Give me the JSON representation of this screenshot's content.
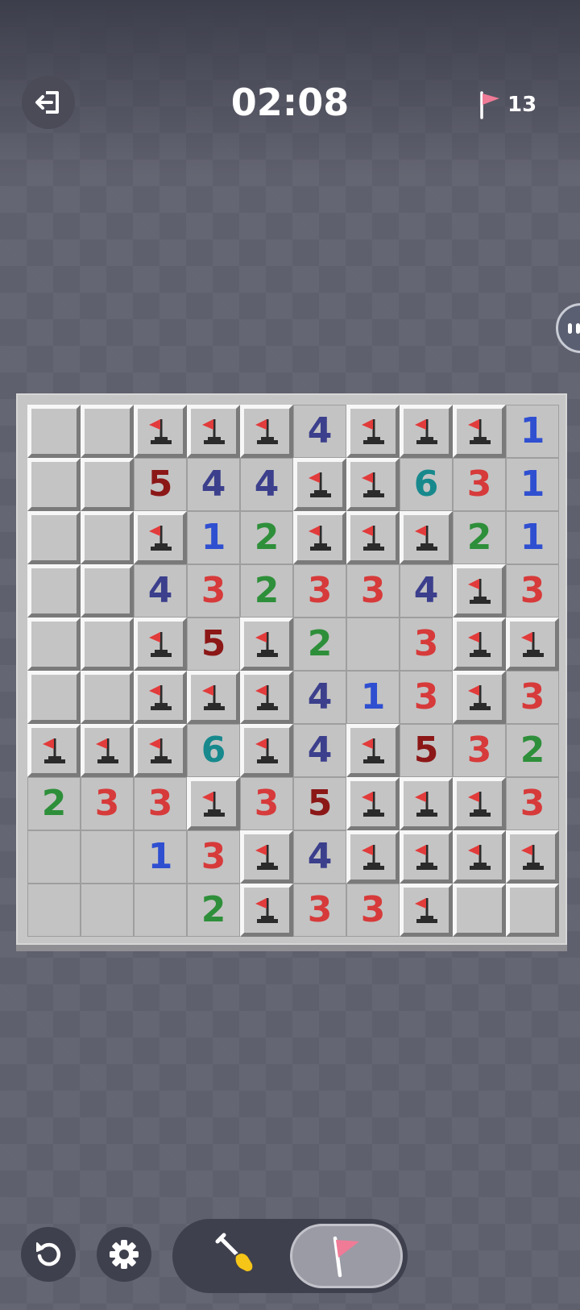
{
  "header": {
    "timer": "02:08",
    "flags_remaining": "13",
    "exit_icon": "exit-icon",
    "flag_icon": "flag-icon"
  },
  "board": {
    "rows": 10,
    "cols": 10,
    "legend": "C = unopened, F = flagged, E = opened empty, digit = opened number",
    "cells": [
      [
        "C",
        "C",
        "F",
        "F",
        "F",
        "4",
        "F",
        "F",
        "F",
        "1"
      ],
      [
        "C",
        "C",
        "5",
        "4",
        "4",
        "F",
        "F",
        "6",
        "3",
        "1"
      ],
      [
        "C",
        "C",
        "F",
        "1",
        "2",
        "F",
        "F",
        "F",
        "2",
        "1"
      ],
      [
        "C",
        "C",
        "4",
        "3",
        "2",
        "3",
        "3",
        "4",
        "F",
        "3"
      ],
      [
        "C",
        "C",
        "F",
        "5",
        "F",
        "2",
        "E",
        "3",
        "F",
        "F"
      ],
      [
        "C",
        "C",
        "F",
        "F",
        "F",
        "4",
        "1",
        "3",
        "F",
        "3"
      ],
      [
        "F",
        "F",
        "F",
        "6",
        "F",
        "4",
        "F",
        "5",
        "3",
        "2"
      ],
      [
        "2",
        "3",
        "3",
        "F",
        "3",
        "5",
        "F",
        "F",
        "F",
        "3"
      ],
      [
        "E",
        "E",
        "1",
        "3",
        "F",
        "4",
        "F",
        "F",
        "F",
        "F"
      ],
      [
        "E",
        "E",
        "E",
        "2",
        "F",
        "3",
        "3",
        "F",
        "C",
        "C"
      ]
    ]
  },
  "controls": {
    "restart_icon": "restart-icon",
    "settings_icon": "gear-icon",
    "dig_icon": "shovel-icon",
    "flag_mode_icon": "flag-icon",
    "active_mode": "flag"
  },
  "colors": {
    "n1": "#2f4fd1",
    "n2": "#2e8f3a",
    "n3": "#d73a3a",
    "n4": "#3b3f8c",
    "n5": "#8c1717",
    "n6": "#17898d",
    "flag_red": "#e23b3b",
    "flag_pink": "#f07b97"
  }
}
